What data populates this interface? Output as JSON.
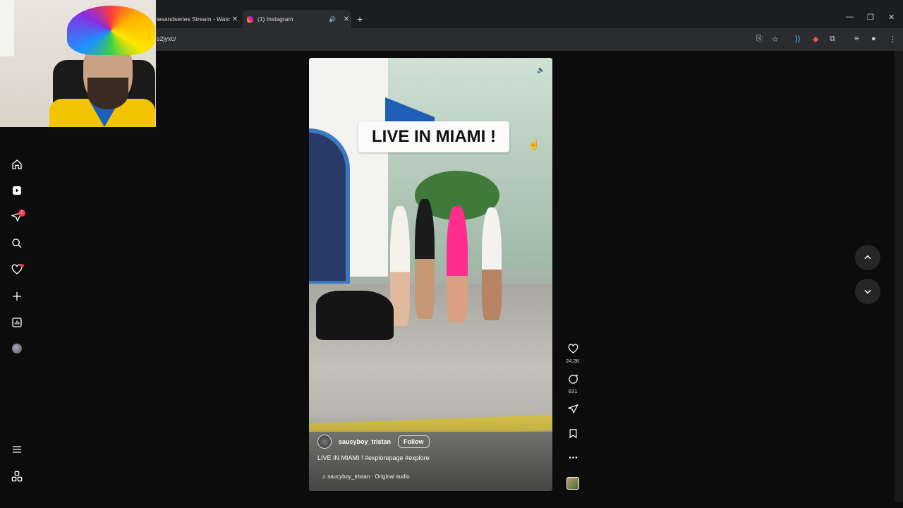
{
  "browser": {
    "tabs": [
      {
        "title": "iesandseries Stream - Watc",
        "active": false
      },
      {
        "title": "(1) Instagram",
        "active": true
      }
    ],
    "url": "s2jyxc/",
    "window_controls": [
      "minimize-icon",
      "restore-icon",
      "close-icon"
    ]
  },
  "nav": {
    "items": [
      "home-icon",
      "reels-icon",
      "messages-icon",
      "search-icon",
      "notifications-icon",
      "create-icon",
      "dashboard-icon",
      "profile-avatar",
      "menu-icon",
      "also-from-meta-icon"
    ],
    "messages_badge": "1"
  },
  "reel": {
    "overlay_text": "LIVE IN MIAMI !",
    "username": "saucyboy_tristan",
    "follow_label": "Follow",
    "caption": "LIVE IN MIAMI ! #explorepage #explore",
    "audio": "saucyboy_tristan · Original audio",
    "likes": "24.2K",
    "comments": "631"
  },
  "colors": {
    "background": "#0c0c0d",
    "badge": "#ff3040",
    "curb": "#d8c24a"
  }
}
